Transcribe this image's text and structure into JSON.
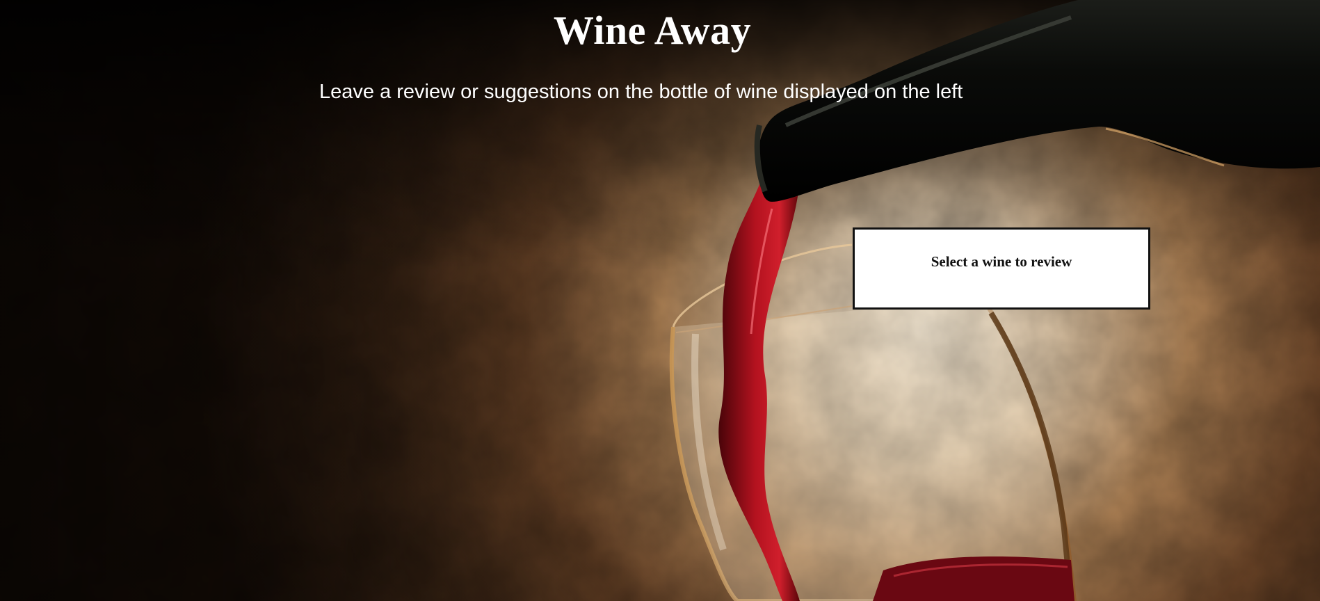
{
  "page": {
    "title": "Wine Away",
    "subtitle": "Leave a review or suggestions on the bottle of wine displayed on the left"
  },
  "review_panel": {
    "prompt": "Select a wine to review"
  },
  "background": {
    "image": "wine-pouring-photo",
    "colors": {
      "wall_light": "#f3e2c8",
      "wall_dark": "#1e120a",
      "wine_red": "#8a0c16",
      "bottle": "#0c0d0b"
    }
  }
}
